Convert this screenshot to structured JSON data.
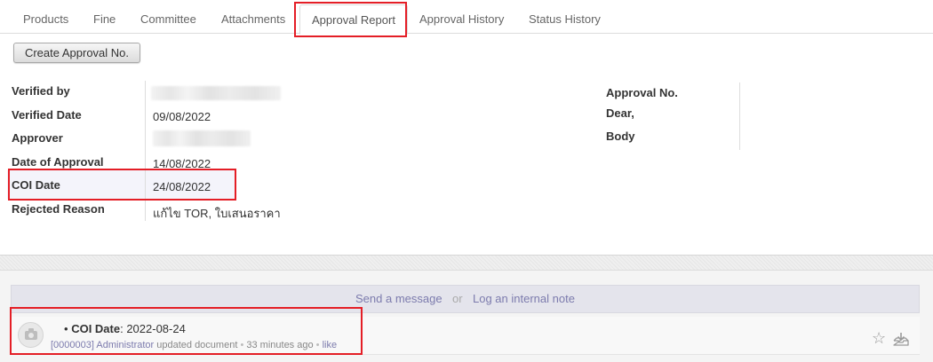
{
  "tabs": [
    {
      "label": "Products"
    },
    {
      "label": "Fine"
    },
    {
      "label": "Committee"
    },
    {
      "label": "Attachments"
    },
    {
      "label": "Approval Report"
    },
    {
      "label": "Approval History"
    },
    {
      "label": "Status History"
    }
  ],
  "active_tab": "Approval Report",
  "actions": {
    "create_approval_label": "Create Approval No."
  },
  "form": {
    "verified_by": {
      "label": "Verified by",
      "value": ""
    },
    "verified_date": {
      "label": "Verified Date",
      "value": "09/08/2022"
    },
    "approver": {
      "label": "Approver",
      "value": ""
    },
    "date_of_approval": {
      "label": "Date of Approval",
      "value": "14/08/2022"
    },
    "coi_date": {
      "label": "COI Date",
      "value": "24/08/2022"
    },
    "rejected_reason": {
      "label": "Rejected Reason",
      "value": "แก้ไข TOR, ใบเสนอราคา"
    },
    "approval_no": {
      "label": "Approval No.",
      "value": ""
    },
    "dear": {
      "label": "Dear,",
      "value": ""
    },
    "body": {
      "label": "Body",
      "value": ""
    }
  },
  "chatter": {
    "send_message": "Send a message",
    "or": "or",
    "log_note": "Log an internal note",
    "message": {
      "bullet": "•",
      "field": "COI Date",
      "value": ": 2022-08-24",
      "author": "[0000003] Administrator",
      "action": "updated document",
      "sep": "•",
      "time": "33 minutes ago",
      "like": "like"
    }
  },
  "icons": {
    "avatar": "camera-icon",
    "star": "star-icon",
    "inbox": "inbox-download-icon"
  },
  "colors": {
    "highlight": "#e41e26",
    "link": "#7c7bad",
    "composer_bg": "#e4e4ec"
  }
}
